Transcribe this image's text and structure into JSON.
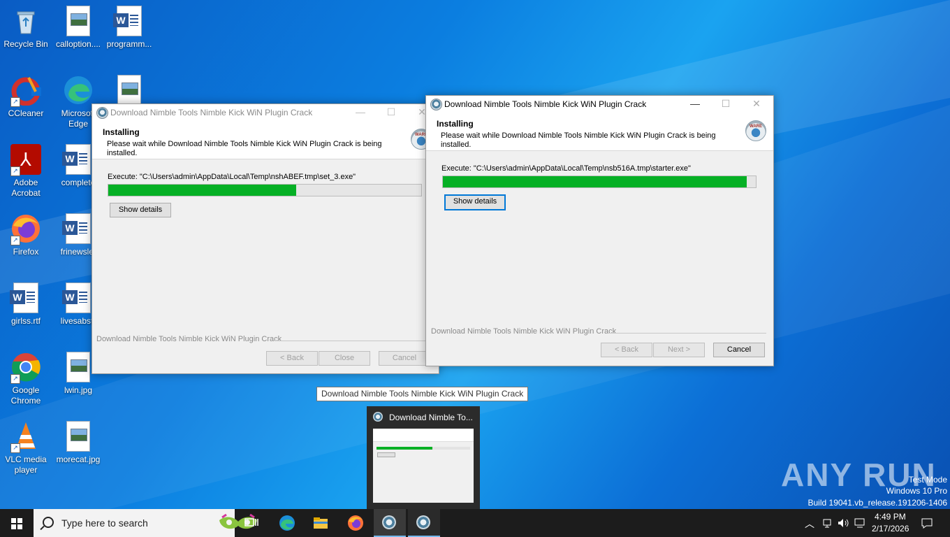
{
  "desktop": {
    "icons": [
      {
        "label": "Recycle Bin"
      },
      {
        "label": "calloption...."
      },
      {
        "label": "programm..."
      },
      {
        "label": "CCleaner"
      },
      {
        "label": "Microsoft Edge"
      },
      {
        "label": "Adobe Acrobat"
      },
      {
        "label": "complete"
      },
      {
        "label": "Firefox"
      },
      {
        "label": "frinewslet"
      },
      {
        "label": "girlss.rtf"
      },
      {
        "label": "livesabstr"
      },
      {
        "label": "Google Chrome"
      },
      {
        "label": "lwin.jpg"
      },
      {
        "label": "VLC media player"
      },
      {
        "label": "morecat.jpg"
      }
    ]
  },
  "window_back": {
    "title": "Download Nimble Tools Nimble Kick WiN  Plugin Crack",
    "heading": "Installing",
    "subheading": "Please wait while Download Nimble Tools Nimble Kick WiN  Plugin Crack is being installed.",
    "exec": "Execute: \"C:\\Users\\admin\\AppData\\Local\\Temp\\nshABEF.tmp\\set_3.exe\"",
    "progress": 0.6,
    "show_details": "Show details",
    "brand": "Download Nimble Tools Nimble Kick WiN  Plugin Crack",
    "back": "< Back",
    "close": "Close",
    "cancel": "Cancel"
  },
  "window_front": {
    "title": "Download Nimble Tools Nimble Kick WiN  Plugin Crack",
    "heading": "Installing",
    "subheading": "Please wait while Download Nimble Tools Nimble Kick WiN  Plugin Crack is being installed.",
    "exec": "Execute: \"C:\\Users\\admin\\AppData\\Local\\Temp\\nsb516A.tmp\\starter.exe\"",
    "progress": 0.97,
    "show_details": "Show details",
    "brand": "Download Nimble Tools Nimble Kick WiN  Plugin Crack",
    "back": "< Back",
    "next": "Next >",
    "cancel": "Cancel"
  },
  "tooltip": "Download Nimble Tools Nimble Kick WiN  Plugin Crack",
  "thumbnail_title": "Download Nimble To...",
  "watermark": "ANY RUN",
  "system_info": {
    "line1": "Test Mode",
    "line2": "Windows 10 Pro",
    "line3": "Build 19041.vb_release.191206-1406"
  },
  "taskbar": {
    "search_placeholder": "Type here to search",
    "time": "4:49 PM",
    "date": "2/17/2026"
  },
  "colors": {
    "progress": "#06b025",
    "taskbar": "#1c1c1c",
    "accent": "#0078d7"
  }
}
